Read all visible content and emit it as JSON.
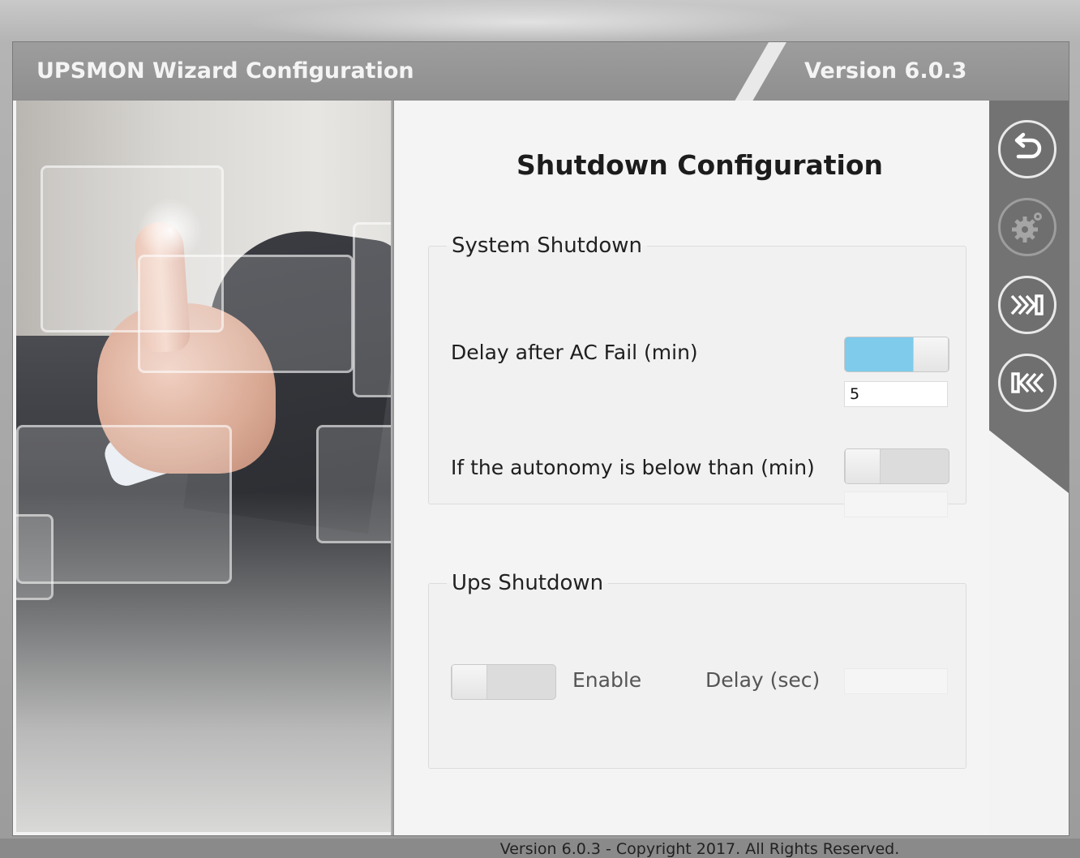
{
  "window": {
    "title": "UPSMON Wizard Configuration",
    "version": "Version 6.0.3"
  },
  "nav": {
    "items": [
      {
        "icon": "back-icon",
        "enabled": true
      },
      {
        "icon": "gear-icon",
        "enabled": false
      },
      {
        "icon": "next-icon",
        "enabled": true
      },
      {
        "icon": "previous-icon",
        "enabled": true
      }
    ]
  },
  "page": {
    "heading": "Shutdown Configuration",
    "system_shutdown": {
      "legend": "System Shutdown",
      "delay_label": "Delay after AC Fail (min)",
      "delay_enabled": true,
      "delay_value": "5",
      "autonomy_label": "If the autonomy is below than (min)",
      "autonomy_enabled": false,
      "autonomy_value": ""
    },
    "ups_shutdown": {
      "legend": "Ups Shutdown",
      "enable_label": "Enable",
      "enabled": false,
      "delay_label": "Delay (sec)",
      "delay_value": ""
    },
    "footer": "Version 6.0.3 - Copyright 2017. All Rights Reserved."
  },
  "colors": {
    "toggle_on": "#7ecbec",
    "titlebar": "#969696",
    "nav_strip": "#737373"
  }
}
